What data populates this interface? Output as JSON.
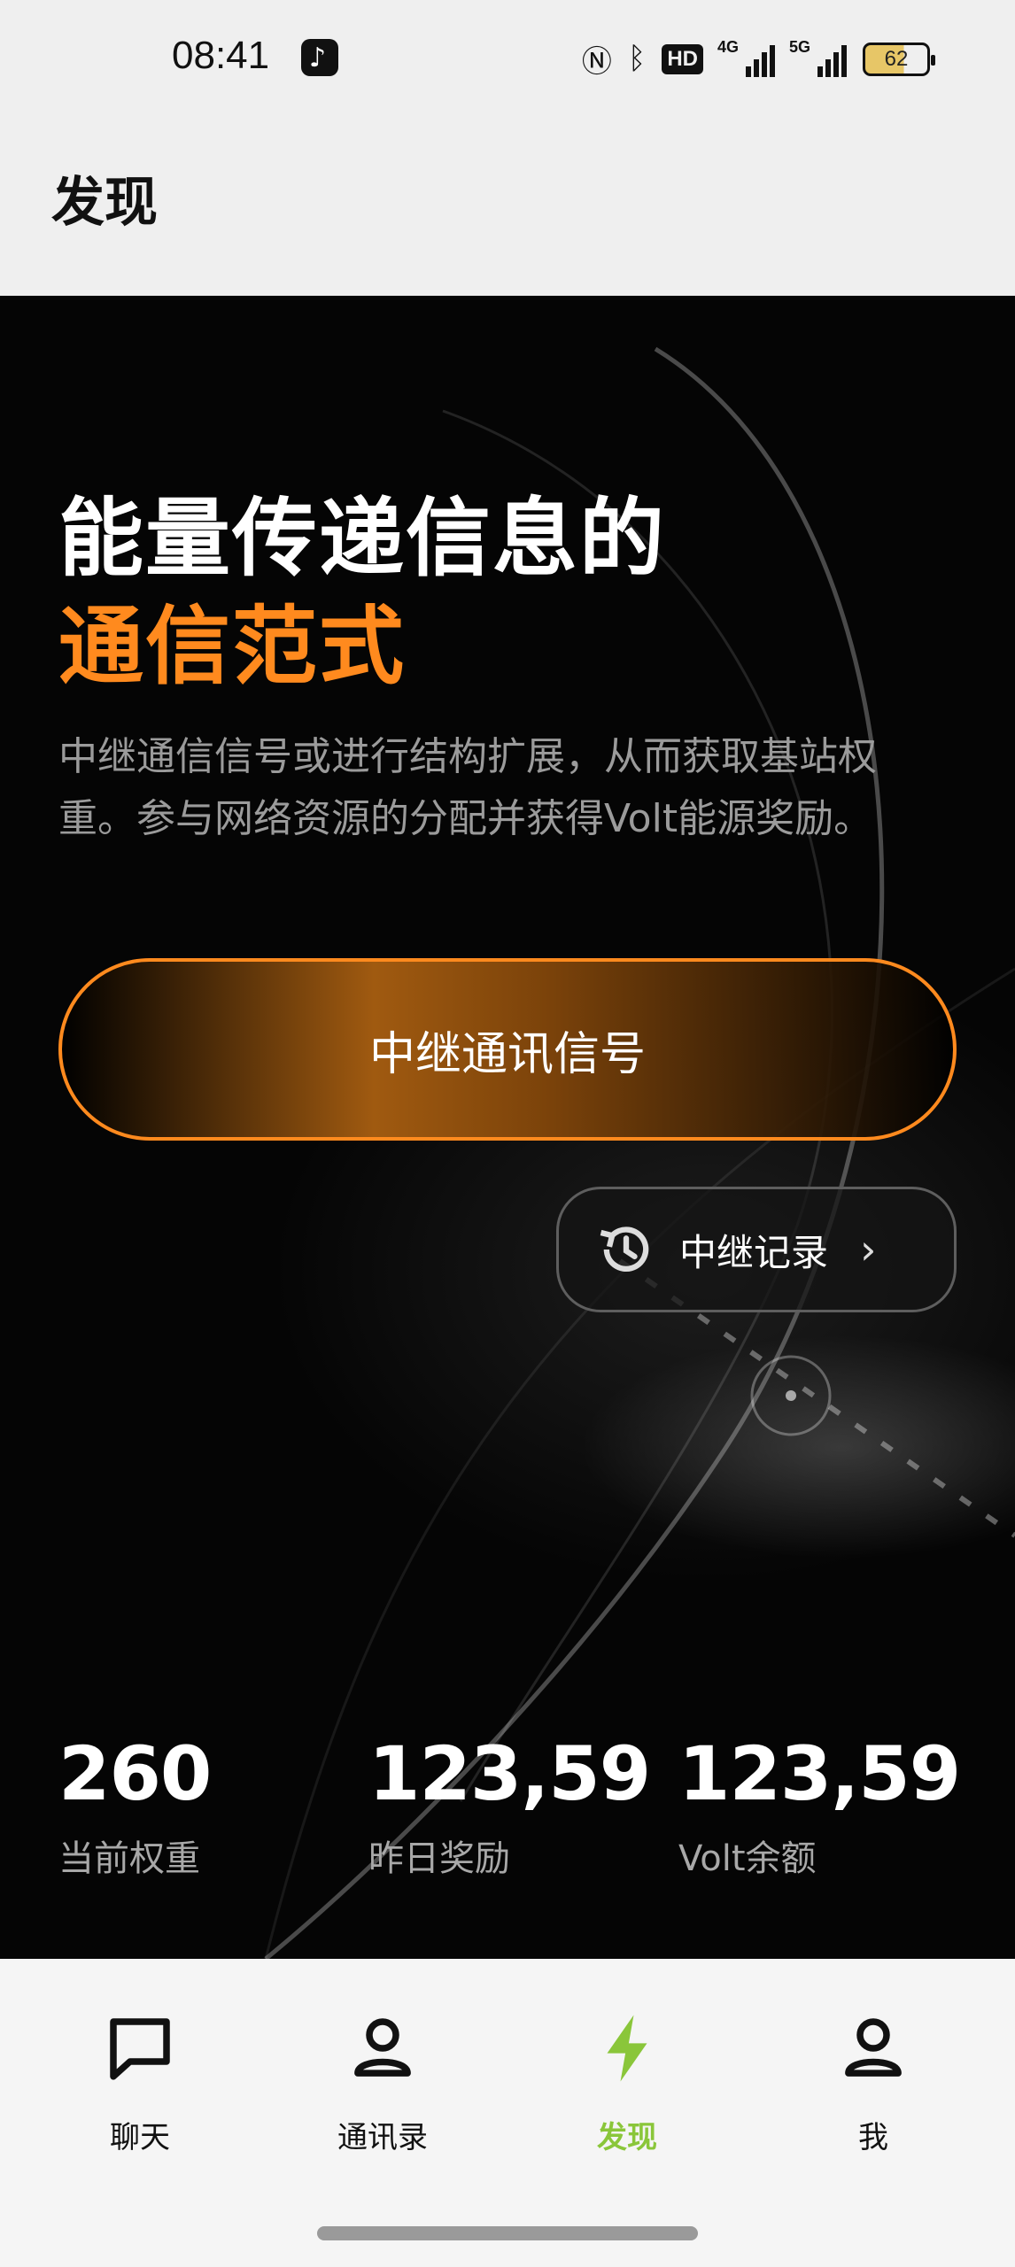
{
  "status_bar": {
    "time": "08:41",
    "hd_label": "HD",
    "network_1": "4G",
    "network_2": "5G",
    "battery": "62"
  },
  "header": {
    "title": "发现"
  },
  "hero": {
    "headline_line1": "能量传递信息的",
    "headline_line2": "通信范式",
    "description": "中继通信信号或进行结构扩展，从而获取基站权重。参与网络资源的分配并获得Volt能源奖励。",
    "accent_color": "#ff8a1e"
  },
  "actions": {
    "relay_button_label": "中继通讯信号",
    "record_button_label": "中继记录"
  },
  "stats": [
    {
      "value": "260",
      "label": "当前权重"
    },
    {
      "value": "123,59",
      "label": "昨日奖励"
    },
    {
      "value": "123,59",
      "label": "Volt余额"
    }
  ],
  "bottom_nav": {
    "items": [
      {
        "label": "聊天",
        "icon": "chat-icon"
      },
      {
        "label": "通讯录",
        "icon": "contacts-icon"
      },
      {
        "label": "发现",
        "icon": "lightning-icon",
        "active": true
      },
      {
        "label": "我",
        "icon": "profile-icon"
      }
    ],
    "active_color": "#8ac63a"
  }
}
